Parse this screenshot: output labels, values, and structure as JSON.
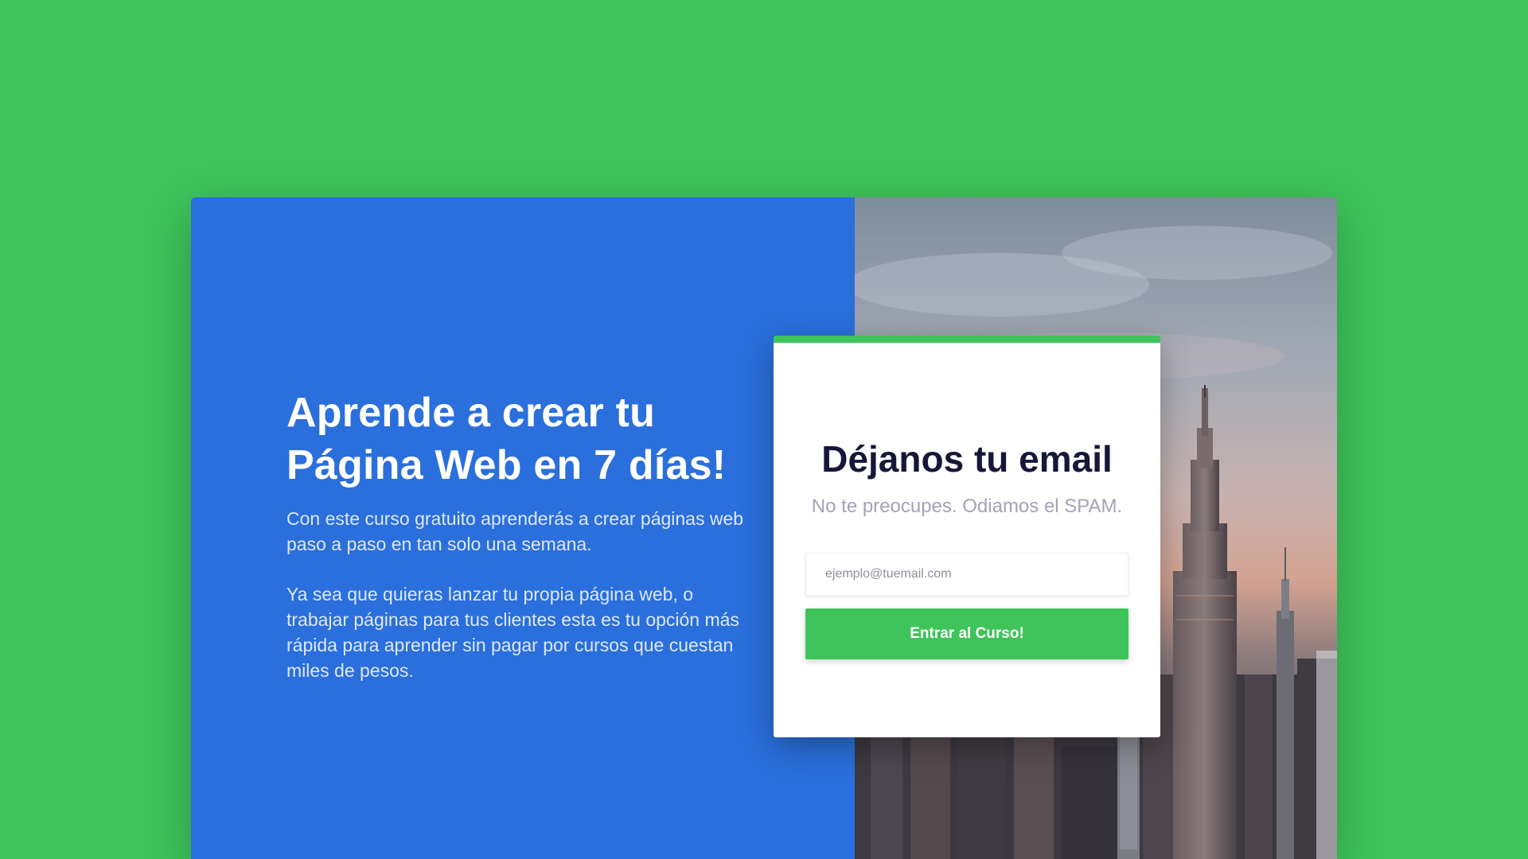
{
  "hero": {
    "headline": "Aprende a crear tu Página Web en 7 días!",
    "paragraph_1": "Con este curso gratuito aprenderás a crear páginas web paso a paso en tan solo una semana.",
    "paragraph_2": "Ya sea que quieras lanzar tu propia página web, o trabajar páginas para tus clientes esta es tu opción más rápida para aprender sin pagar por cursos que cuestan miles de pesos."
  },
  "signup_form": {
    "title": "Déjanos tu email",
    "subtitle": "No te preocupes. Odiamos el SPAM.",
    "email_placeholder": "ejemplo@tuemail.com",
    "email_value": "",
    "submit_label": "Entrar al Curso!"
  },
  "image": {
    "subject": "city skyline with tall spire skyscraper"
  },
  "colors": {
    "background": "#3ec45b",
    "panel_blue": "#2a6fdb",
    "accent_green": "#3ec45b",
    "title_dark": "#17173a",
    "subtitle_gray": "#a2a3b8"
  }
}
